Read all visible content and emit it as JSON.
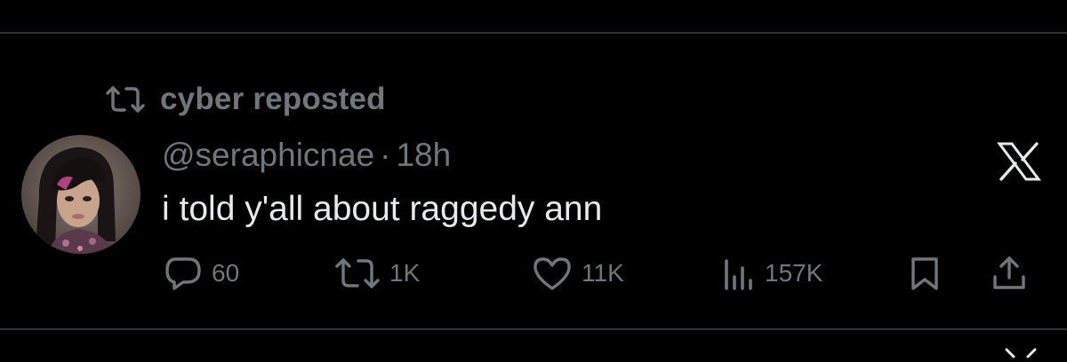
{
  "repost_banner": {
    "icon": "repost-icon",
    "text": "cyber reposted"
  },
  "tweet": {
    "handle": "@seraphicnae",
    "separator": "·",
    "time": "18h",
    "text": "i told y'all about raggedy ann",
    "platform_icon": "x-logo-icon"
  },
  "actions": {
    "replies": "60",
    "reposts": "1K",
    "likes": "11K",
    "views": "157K"
  },
  "colors": {
    "background": "#000000",
    "text_primary": "#e7e9ea",
    "text_secondary": "#71767b",
    "divider": "#2f3336"
  }
}
